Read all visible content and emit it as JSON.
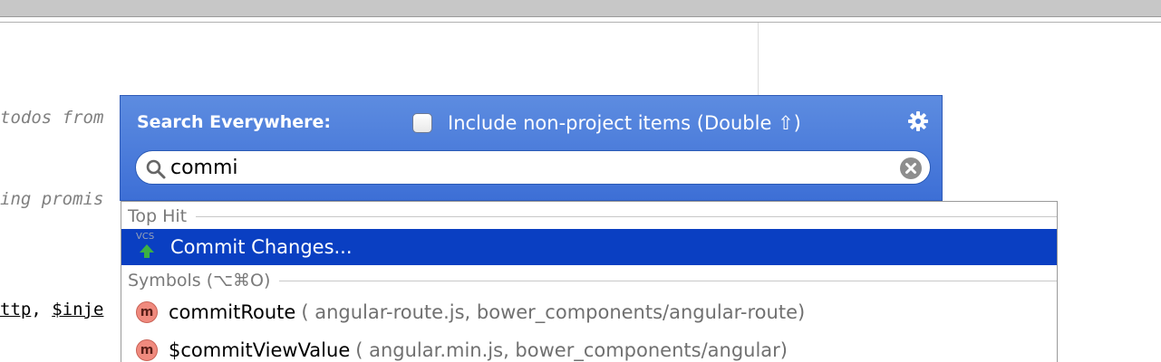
{
  "editor": {
    "line1": "todos from",
    "line2": "ing promis",
    "line3_a": "ttp",
    "line3_b": ", ",
    "line3_c": "$inje"
  },
  "popup": {
    "title": "Search Everywhere:",
    "include_label": "Include non-project items (Double ⇧)",
    "include_checked": false,
    "gear_icon": "gear-icon",
    "search_value": "commi",
    "search_icon": "search-icon",
    "clear_icon": "clear-icon"
  },
  "results": {
    "groups": [
      {
        "label": "Top Hit",
        "items": [
          {
            "name": "Commit Changes...",
            "icon": "vcs-commit-icon",
            "icon_text": "VCS",
            "selected": true
          }
        ]
      },
      {
        "label": "Symbols (⌥⌘O)",
        "items": [
          {
            "name": "commitRoute",
            "location": "( angular-route.js, bower_components/angular-route)",
            "icon": "method-icon",
            "icon_letter": "m"
          },
          {
            "name": "$commitViewValue",
            "location": "( angular.min.js, bower_components/angular)",
            "icon": "method-icon",
            "icon_letter": "m"
          }
        ]
      }
    ]
  },
  "colors": {
    "popup_blue": "#4a7ddb",
    "selection_blue": "#0a3fc2",
    "method_icon": "#f08a7e"
  }
}
